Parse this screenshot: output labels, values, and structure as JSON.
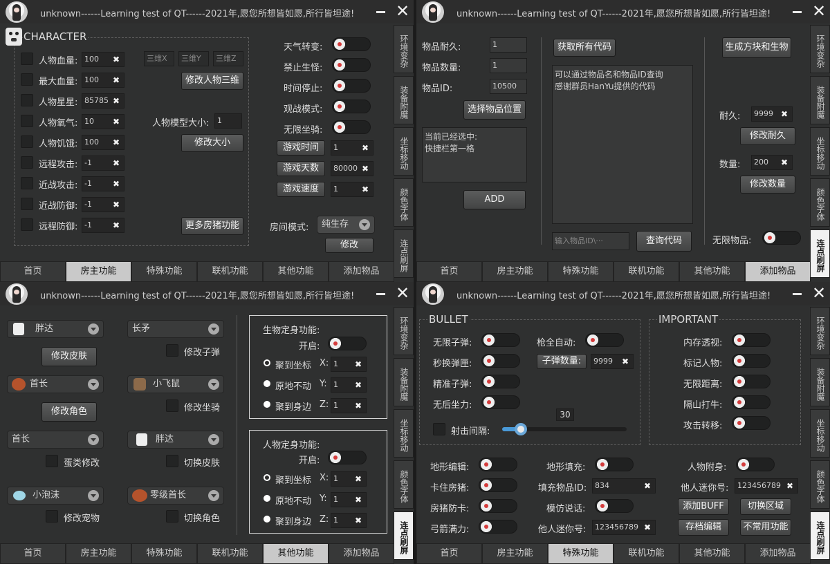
{
  "window_title": "unknown------Learning test of QT------2021年,愿您所想皆如愿,所行皆坦途!",
  "close_glyph": "✕",
  "clear_glyph": "✖",
  "side_tabs": [
    "环境变杂",
    "装备附魔",
    "坐标移动",
    "颜色字体",
    "连点刷屏"
  ],
  "bottom_tabs": [
    "首页",
    "房主功能",
    "特殊功能",
    "联机功能",
    "其他功能",
    "添加物品"
  ],
  "w1": {
    "section": "CHARACTER",
    "stats": [
      {
        "label": "人物血量:",
        "value": "100"
      },
      {
        "label": "最大血量:",
        "value": "100"
      },
      {
        "label": "人物星星:",
        "value": "85785"
      },
      {
        "label": "人物氧气:",
        "value": "10"
      },
      {
        "label": "人物饥饿:",
        "value": "100"
      },
      {
        "label": "远程攻击:",
        "value": "-1"
      },
      {
        "label": "近战攻击:",
        "value": "-1"
      },
      {
        "label": "近战防御:",
        "value": "-1"
      },
      {
        "label": "远程防御:",
        "value": "-1"
      }
    ],
    "dim_placeholders": [
      "三维X",
      "三维Y",
      "三维Z"
    ],
    "modify_3d": "修改人物三维",
    "model_size_label": "人物模型大小:",
    "model_size_value": "1",
    "modify_size": "修改大小",
    "more_host": "更多房猪功能",
    "toggles": [
      "天气转变:",
      "禁止生怪:",
      "时间停止:",
      "观战模式:",
      "无限坐骑:"
    ],
    "game_buttons": [
      {
        "label": "游戏时间",
        "value": "1"
      },
      {
        "label": "游戏天数",
        "value": "80000"
      },
      {
        "label": "游戏速度",
        "value": "1"
      }
    ],
    "room_mode_label": "房间模式:",
    "room_mode_value": "纯生存",
    "modify": "修改"
  },
  "w2": {
    "durability_label": "物品耐久:",
    "durability_value": "1",
    "count_label": "物品数量:",
    "count_value": "1",
    "id_label": "物品ID:",
    "id_value": "10500",
    "select_slot": "选择物品位置",
    "selected_text": "当前已经选中:\n快捷栏第一格",
    "add": "ADD",
    "get_codes": "获取所有代码",
    "info_text": "可以通过物品名和物品ID查询\n感谢群员HanYu提供的代码",
    "search_placeholder": "输入物品ID\\···",
    "query_code": "查询代码",
    "gen_block": "生成方块和生物",
    "dur_label": "耐久:",
    "dur_value": "9999",
    "modify_dur": "修改耐久",
    "num_label": "数量:",
    "num_value": "200",
    "modify_num": "修改数量",
    "infinite_label": "无限物品:"
  },
  "w3": {
    "left_combos": [
      "胖达",
      "首长",
      "首长",
      "小泡沫"
    ],
    "left_buttons": [
      "修改皮肤",
      "修改角色"
    ],
    "left_checks": [
      "蛋类修改",
      "修改宠物"
    ],
    "mid_combos": [
      "长矛",
      "小飞鼠",
      "胖达",
      "零级首长"
    ],
    "mid_checks": [
      "修改子弹",
      "修改坐骑",
      "切换皮肤",
      "切换角色"
    ],
    "box1_title": "生物定身功能:",
    "box2_title": "人物定身功能:",
    "open_label": "开启:",
    "radio_labels": [
      "聚到坐标",
      "原地不动",
      "聚到身边"
    ],
    "axis_labels": [
      "X:",
      "Y:",
      "Z:"
    ],
    "axis_values": [
      "1",
      "1",
      "1"
    ]
  },
  "w4": {
    "bullet_title": "BULLET",
    "important_title": "IMPORTANT",
    "bullet_toggles": [
      "无限子弹:",
      "秒换弹匣:",
      "精准子弹:",
      "无后坐力:"
    ],
    "full_auto": "枪全自动:",
    "bullet_count_btn": "子弹数量:",
    "bullet_count_value": "9999",
    "fire_interval": "射击间隔:",
    "slider_value": "30",
    "slider_fraction": 0.15,
    "important_toggles": [
      "内存透视:",
      "标记人物:",
      "无限距离:",
      "隔山打牛:",
      "攻击转移:"
    ],
    "bottom_left": [
      "地形编辑:",
      "卡住房猪:",
      "房猪防卡:",
      "弓箭满力:"
    ],
    "terrain_fill": "地形填充:",
    "fill_id_label": "填充物品ID:",
    "fill_id_value": "834",
    "mimic": "模仿说话:",
    "other_mini_label": "他人迷你号:",
    "other_mini_value": "123456789",
    "possess": "人物附身:",
    "mini_label_r": "他人迷你号:",
    "mini_value_r": "123456789",
    "add_buff": "添加BUFF",
    "switch_area": "切换区域",
    "save_edit": "存档编辑",
    "rare_funcs": "不常用功能"
  }
}
